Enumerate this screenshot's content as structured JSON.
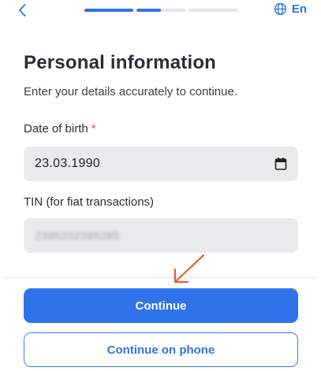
{
  "header": {
    "back_icon": "chevron-left-icon",
    "progress": {
      "steps": 3,
      "current_step": 1,
      "current_step_fraction": 0.5
    },
    "language_label": "En",
    "language_icon": "globe-icon"
  },
  "page": {
    "title": "Personal information",
    "subtitle": "Enter your details accurately to continue."
  },
  "fields": {
    "dob": {
      "label": "Date of birth",
      "required_mark": "*",
      "value": "23.03.1990",
      "icon": "calendar-icon"
    },
    "tin": {
      "label": "TIN (for fiat transactions)",
      "value": "2395202395285"
    }
  },
  "actions": {
    "continue_label": "Continue",
    "continue_on_phone_label": "Continue on phone"
  },
  "colors": {
    "accent": "#2f73ea",
    "required": "#e5484d",
    "annotation_arrow": "#f05a28",
    "field_bg": "#e9eaeb"
  }
}
